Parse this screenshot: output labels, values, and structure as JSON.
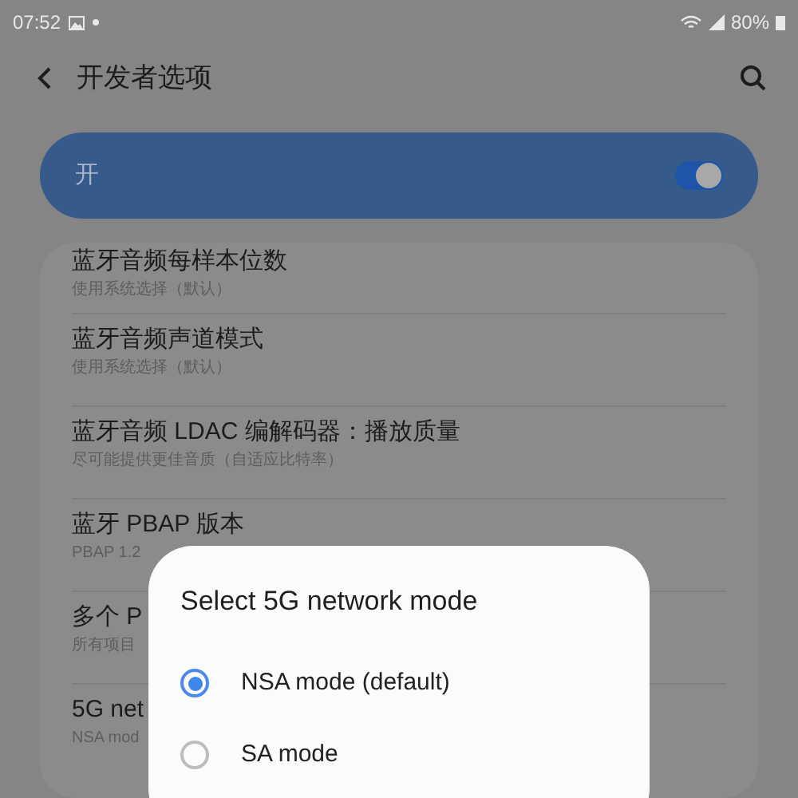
{
  "status_bar": {
    "time": "07:52",
    "battery": "80%"
  },
  "header": {
    "title": "开发者选项"
  },
  "master_switch": {
    "label": "开",
    "on": true
  },
  "settings": [
    {
      "title": "蓝牙音频每样本位数",
      "subtitle": "使用系统选择（默认）"
    },
    {
      "title": "蓝牙音频声道模式",
      "subtitle": "使用系统选择（默认）"
    },
    {
      "title": "蓝牙音频 LDAC 编解码器：播放质量",
      "subtitle": "尽可能提供更佳音质（自适应比特率）"
    },
    {
      "title": "蓝牙 PBAP 版本",
      "subtitle": "PBAP 1.2"
    },
    {
      "title": "多个 P",
      "subtitle": "所有项目"
    },
    {
      "title": "5G net",
      "subtitle": "NSA mod"
    }
  ],
  "dialog": {
    "title": "Select 5G network mode",
    "options": [
      {
        "label": "NSA mode (default)",
        "selected": true
      },
      {
        "label": "SA mode",
        "selected": false
      }
    ]
  }
}
